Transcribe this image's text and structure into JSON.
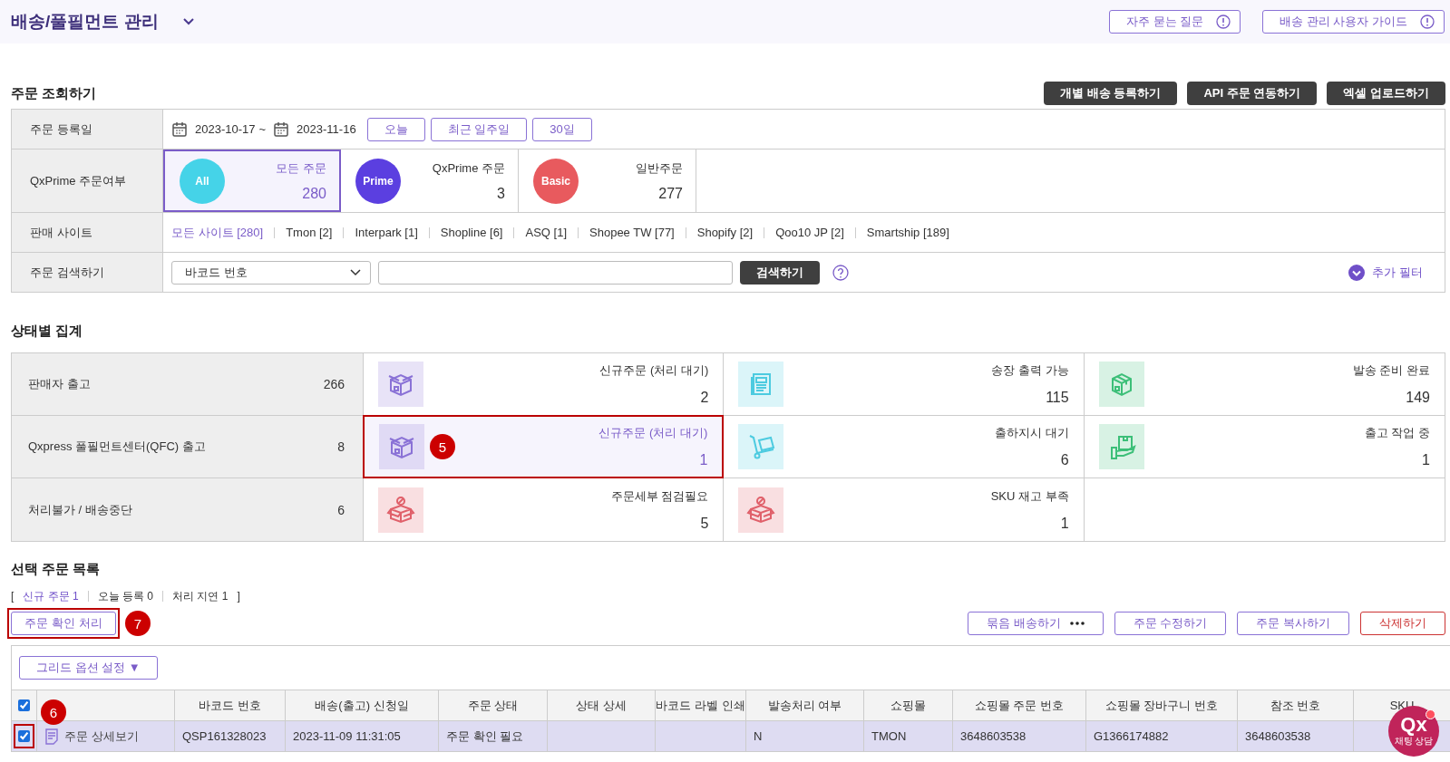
{
  "header": {
    "title": "배송/풀필먼트 관리",
    "links": [
      "자주 묻는 질문",
      "배송 관리 사용자 가이드"
    ]
  },
  "search_section": {
    "title": "주문 조회하기",
    "actions": [
      "개별 배송 등록하기",
      "API 주문 연동하기",
      "엑셀 업로드하기"
    ]
  },
  "filters": {
    "date": {
      "label": "주문 등록일",
      "from": "2023-10-17",
      "separator": "~",
      "to": "2023-11-16",
      "presets": [
        "오늘",
        "최근 일주일",
        "30일"
      ]
    },
    "prime": {
      "label": "QxPrime 주문여부",
      "options": [
        {
          "badge": "All",
          "color": "#45d3e8",
          "name": "모든 주문",
          "count": "280",
          "selected": true
        },
        {
          "badge": "Prime",
          "color": "#5b3fe0",
          "name": "QxPrime 주문",
          "count": "3",
          "selected": false
        },
        {
          "badge": "Basic",
          "color": "#e85a5e",
          "name": "일반주문",
          "count": "277",
          "selected": false
        }
      ]
    },
    "sites": {
      "label": "판매 사이트",
      "items": [
        {
          "text": "모든 사이트 [280]",
          "selected": true
        },
        {
          "text": "Tmon [2]",
          "selected": false
        },
        {
          "text": "Interpark [1]",
          "selected": false
        },
        {
          "text": "Shopline [6]",
          "selected": false
        },
        {
          "text": "ASQ [1]",
          "selected": false
        },
        {
          "text": "Shopee TW [77]",
          "selected": false
        },
        {
          "text": "Shopify [2]",
          "selected": false
        },
        {
          "text": "Qoo10 JP [2]",
          "selected": false
        },
        {
          "text": "Smartship [189]",
          "selected": false
        }
      ]
    },
    "search": {
      "label": "주문 검색하기",
      "select_value": "바코드 번호",
      "button": "검색하기",
      "more_filter": "추가 필터"
    }
  },
  "status_section": {
    "title": "상태별 집계",
    "rows": [
      {
        "label": "판매자 출고",
        "count": "266",
        "cards": [
          {
            "kind": "box",
            "color": "#8a72d6",
            "name": "신규주문 (처리 대기)",
            "count": "2",
            "highlighted": false
          },
          {
            "kind": "invoice",
            "color": "#4ccbe0",
            "name": "송장 출력 가능",
            "count": "115",
            "highlighted": false
          },
          {
            "kind": "package",
            "color": "#3cbf78",
            "name": "발송 준비 완료",
            "count": "149",
            "highlighted": false
          }
        ]
      },
      {
        "label": "Qxpress 풀필먼트센터(QFC) 출고",
        "count": "8",
        "cards": [
          {
            "kind": "box",
            "color": "#8a72d6",
            "name": "신규주문 (처리 대기)",
            "count": "1",
            "highlighted": true,
            "marker": "5"
          },
          {
            "kind": "cart",
            "color": "#4ccbe0",
            "name": "출하지시 대기",
            "count": "6",
            "highlighted": false
          },
          {
            "kind": "hand",
            "color": "#3cbf78",
            "name": "출고 작업 중",
            "count": "1",
            "highlighted": false
          }
        ]
      },
      {
        "label": "처리불가 / 배송중단",
        "count": "6",
        "cards": [
          {
            "kind": "blocked",
            "color": "#e0606a",
            "name": "주문세부 점검필요",
            "count": "5",
            "highlighted": false
          },
          {
            "kind": "blocked",
            "color": "#e0606a",
            "name": "SKU 재고 부족",
            "count": "1",
            "highlighted": false
          }
        ]
      }
    ]
  },
  "order_list": {
    "title": "선택 주문 목록",
    "summary": [
      {
        "text": "신규 주문 1",
        "selected": true
      },
      {
        "text": "오늘 등록 0",
        "selected": false
      },
      {
        "text": "처리 지연 1",
        "selected": false
      }
    ],
    "open_bracket": "[",
    "close_bracket": "]",
    "confirm_button": {
      "label": "주문 확인 처리",
      "marker": "7"
    },
    "actions": [
      {
        "label": "묶음 배송하기",
        "kind": "more"
      },
      {
        "label": "주문 수정하기",
        "kind": "normal"
      },
      {
        "label": "주문 복사하기",
        "kind": "normal"
      },
      {
        "label": "삭제하기",
        "kind": "danger"
      }
    ],
    "grid_option": "그리드 옵션 설정",
    "grid_option_caret": "▼",
    "header_checked": true,
    "checkbox_marker": "6",
    "columns": [
      "",
      "바코드 번호",
      "배송(출고) 신청일",
      "주문 상태",
      "상태 상세",
      "바코드 라벨 인쇄",
      "발송처리 여부",
      "쇼핑몰",
      "쇼핑몰 주문 번호",
      "쇼핑몰 장바구니 번호",
      "참조 번호",
      "SKU"
    ],
    "rows": [
      {
        "checked": true,
        "selected": true,
        "cells": [
          "주문 상세보기",
          "QSP161328023",
          "2023-11-09 11:31:05",
          "주문 확인 필요",
          "",
          "",
          "N",
          "TMON",
          "3648603538",
          "G1366174882",
          "3648603538",
          ""
        ]
      }
    ]
  },
  "chat": {
    "logo": "Qx",
    "label": "채팅 상담"
  }
}
